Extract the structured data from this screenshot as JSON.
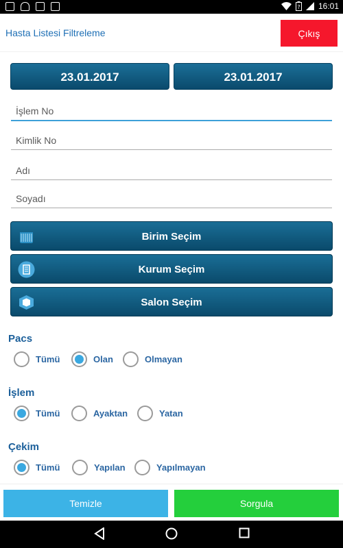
{
  "status_bar": {
    "time": "16:01"
  },
  "app": {
    "title": "Hasta Listesi Filtreleme",
    "exit_label": "Çıkış"
  },
  "dates": {
    "start": "23.01.2017",
    "end": "23.01.2017"
  },
  "fields": {
    "islem_no": {
      "placeholder": "İşlem No",
      "value": ""
    },
    "kimlik_no": {
      "placeholder": "Kimlik No",
      "value": ""
    },
    "adi": {
      "placeholder": "Adı",
      "value": ""
    },
    "soyadi": {
      "placeholder": "Soyadı",
      "value": ""
    }
  },
  "selection_buttons": {
    "birim": {
      "label": "Birim Seçim",
      "icon": "building-columns-icon"
    },
    "kurum": {
      "label": "Kurum Seçim",
      "icon": "office-building-icon"
    },
    "salon": {
      "label": "Salon Seçim",
      "icon": "cube-room-icon"
    }
  },
  "pacs": {
    "title": "Pacs",
    "options": [
      "Tümü",
      "Olan",
      "Olmayan"
    ],
    "selected": "Olan"
  },
  "islem": {
    "title": "İşlem",
    "options": [
      "Tümü",
      "Ayaktan",
      "Yatan"
    ],
    "selected": "Tümü"
  },
  "cekim": {
    "title": "Çekim",
    "options": [
      "Tümü",
      "Yapılan",
      "Yapılmayan"
    ],
    "selected": "Tümü"
  },
  "actions": {
    "clear_label": "Temizle",
    "query_label": "Sorgula"
  },
  "colors": {
    "accent": "#1e6fb5",
    "exit": "#f5172c",
    "clear": "#3cb3e6",
    "query": "#24cf3c",
    "dark_button": "#0a4a6c",
    "radio_on": "#3aa8e0"
  }
}
